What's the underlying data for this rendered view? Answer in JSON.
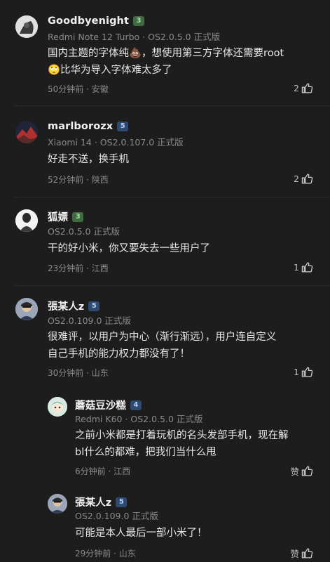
{
  "comments": [
    {
      "username": "Goodbyenight",
      "level": "3",
      "device": "Redmi Note 12 Turbo · OS2.0.5.0 正式版",
      "text_line1": "国内主题的字体纯💩，想使用第三方字体还需要root",
      "text_line2": "🙄比华为导入字体难太多了",
      "time_location": "50分钟前 · 安徽",
      "likes": "2"
    },
    {
      "username": "marlborozx",
      "level": "5",
      "device": "Xiaomi 14 · OS2.0.107.0 正式版",
      "text_line1": "好走不送，换手机",
      "time_location": "52分钟前 · 陕西",
      "likes": "2"
    },
    {
      "username": "狐嫖",
      "level": "3",
      "device": "OS2.0.5.0 正式版",
      "text_line1": "干的好小米，你又要失去一些用户了",
      "time_location": "23分钟前 · 江西",
      "likes": "1"
    },
    {
      "username": "張某人z",
      "level": "5",
      "device": "OS2.0.109.0 正式版",
      "text_line1": "很难评，以用户为中心（渐行渐远），用户连自定义",
      "text_line2": "自己手机的能力权力都没有了！",
      "time_location": "30分钟前 · 山东",
      "likes": "1"
    }
  ],
  "replies": [
    {
      "username": "蘑菇豆沙糕",
      "level": "4",
      "device": "Redmi K60 · OS2.0.5.0 正式版",
      "text_line1": "之前小米都是打着玩机的名头发部手机，现在解",
      "text_line2": "bl什么的都难，把我们当什么甩",
      "time_location": "6分钟前 · 江西",
      "likes": "赞"
    },
    {
      "username": "張某人z",
      "level": "5",
      "device": "OS2.0.109.0 正式版",
      "text_line1": "可能是本人最后一部小米了！",
      "time_location": "29分钟前 · 山东",
      "likes": "赞"
    }
  ]
}
